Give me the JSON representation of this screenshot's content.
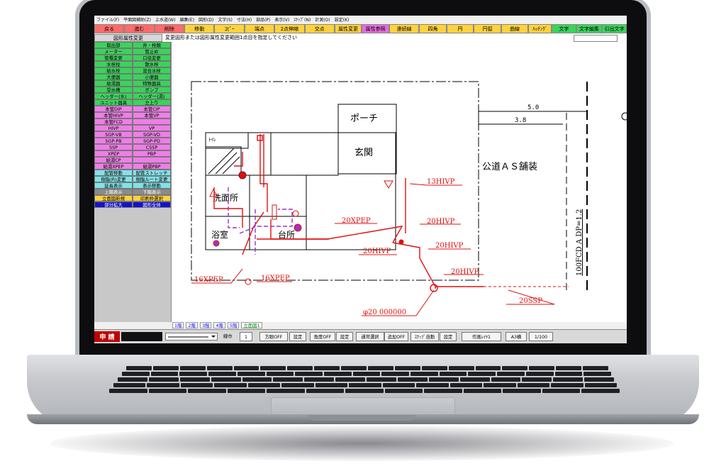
{
  "menu": [
    "ファイル(F)",
    "平面図補助(Z)",
    "上水道(W)",
    "編集(E)",
    "図形(D)",
    "文字(S)",
    "寸法(H)",
    "部品(P)",
    "表示(V)",
    "ｽﾅｯﾌﾟ(N)",
    "計測(O)",
    "設定(K)"
  ],
  "toolbar": [
    {
      "label": "戻る",
      "color": "#ff6a6a",
      "w": 44
    },
    {
      "label": "進む",
      "color": "#ff6a6a",
      "w": 44
    },
    {
      "label": "削除",
      "color": "#ff6a6a",
      "w": 44
    },
    {
      "label": "移動",
      "color": "#ffd23c",
      "w": 44
    },
    {
      "label": "ｺﾋﾟｰ",
      "color": "#ffd23c",
      "w": 44
    },
    {
      "label": "端点",
      "color": "#ffd23c",
      "w": 44
    },
    {
      "label": "2点伸縮",
      "color": "#ffd23c",
      "w": 44
    },
    {
      "label": "交点",
      "color": "#ffd23c",
      "w": 44
    },
    {
      "label": "属性変更",
      "color": "#ffd23c",
      "w": 40
    },
    {
      "label": "属性参照",
      "color": "#e86be0",
      "w": 40
    },
    {
      "label": "連続線",
      "color": "#ffd23c",
      "w": 44
    },
    {
      "label": "四角",
      "color": "#ffd23c",
      "w": 40
    },
    {
      "label": "円",
      "color": "#ffd23c",
      "w": 40
    },
    {
      "label": "円弧",
      "color": "#ffd23c",
      "w": 40
    },
    {
      "label": "曲線",
      "color": "#ffd23c",
      "w": 40
    },
    {
      "label": "ﾊｯﾁﾝｸﾞ",
      "color": "#ffd23c",
      "w": 34
    },
    {
      "label": "文字",
      "color": "#39d45a",
      "w": 36
    },
    {
      "label": "文字編集",
      "color": "#39d45a",
      "w": 38
    },
    {
      "label": "引出文字",
      "color": "#39d45a",
      "w": 36
    }
  ],
  "command": {
    "name": "図形属性変更",
    "message": "変更図形または図形属性変更範囲1点目を指定してください"
  },
  "palette": [
    {
      "l": "取出部",
      "r": "弁・栓類",
      "c": "#39d45a"
    },
    {
      "l": "メーター",
      "r": "管止め",
      "c": "#39d45a"
    },
    {
      "l": "管種変更",
      "r": "口径変更",
      "c": "#39d45a"
    },
    {
      "l": "水栓柱",
      "r": "散水栓",
      "c": "#39d45a"
    },
    {
      "l": "給水栓",
      "r": "混合水栓",
      "c": "#39d45a"
    },
    {
      "l": "大便器",
      "r": "小便器",
      "c": "#39d45a"
    },
    {
      "l": "給湯器",
      "r": "特殊器具",
      "c": "#39d45a"
    },
    {
      "l": "受水槽",
      "r": "ポンプ",
      "c": "#39d45a"
    },
    {
      "l": "ヘッダー(水)",
      "r": "ヘッダー(湯)",
      "c": "#39d45a"
    },
    {
      "l": "ユニット器具",
      "r": "立上り",
      "c": "#39d45a"
    },
    {
      "l": "本管DIP",
      "r": "本管CIP",
      "c": "#f07de8"
    },
    {
      "l": "本管HIVP",
      "r": "本管VP",
      "c": "#f07de8"
    },
    {
      "l": "本管FCD",
      "r": "",
      "c": "#f07de8"
    },
    {
      "l": "HIVP",
      "r": "VP",
      "c": "#f07de8"
    },
    {
      "l": "SGP-VB",
      "r": "SGP-VD",
      "c": "#f07de8"
    },
    {
      "l": "SGP-PB",
      "r": "SGP-PD",
      "c": "#f07de8"
    },
    {
      "l": "SSP",
      "r": "CSSP",
      "c": "#f07de8"
    },
    {
      "l": "XPEP",
      "r": "PBP",
      "c": "#f07de8"
    },
    {
      "l": "給湯CP",
      "r": "",
      "c": "#f07de8"
    },
    {
      "l": "給湯XPEP",
      "r": "給湯PBP",
      "c": "#f07de8"
    },
    {
      "l": "配管移動",
      "r": "配管ストレッチ",
      "c": "#7fe3e8"
    },
    {
      "l": "樹脂(R)変更",
      "r": "樹脂ルート変更",
      "c": "#7fe3e8"
    },
    {
      "l": "延長表示",
      "r": "表示移動",
      "c": "#7fe3e8"
    },
    {
      "l": "上階表示",
      "r": "下階表示",
      "c": "#8a8a8a"
    },
    {
      "l": "立面図新規",
      "r": "印刷枠選択",
      "c": "#ffd23c"
    },
    {
      "l": "部分拡大",
      "r": "図形全体",
      "c": "#1414c8"
    }
  ],
  "drawing": {
    "rooms": {
      "porch": "ポーチ",
      "entrance": "玄関",
      "washroom": "洗面所",
      "bath": "浴室",
      "kitchen": "台所",
      "toilet": "ﾄｲﾚ"
    },
    "road": "公道ＡＳ舗装",
    "dim_outer": "5.0",
    "dim_inner": "3.8",
    "main_pipe": "100FCD A DP=1.2",
    "labels": [
      "13HIVP",
      "20XPEP",
      "20HIVP",
      "20HIVP",
      "20HIVP",
      "20HIVP",
      "16XPEP",
      "16XPEP",
      "20SSP",
      "φ20 000000"
    ]
  },
  "layer_tabs": [
    "1階",
    "2階",
    "3階",
    "4階",
    "5階",
    "立面図1"
  ],
  "status": {
    "apply": "申 請",
    "linewidth_label": "線巾",
    "linewidth_value": "1",
    "ortho": "方眼OFF",
    "set1": "設定",
    "angle": "角度OFF",
    "set2": "設定",
    "select": "通常選択",
    "add": "追加OFF",
    "snap": "ｽﾅｯﾌﾟ自動",
    "set3": "設定",
    "layer": "作画ﾚｲﾔ1",
    "paper": "A3横",
    "scale": "1/100"
  }
}
